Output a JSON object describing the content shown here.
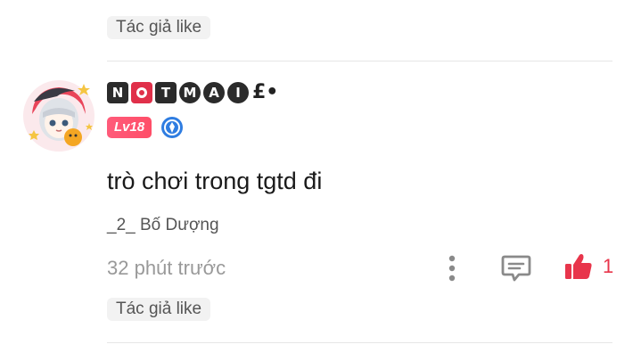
{
  "top_comment": {
    "author_like_label": "Tác giả like"
  },
  "comment": {
    "username_chars": [
      "N",
      "O",
      "T",
      "M",
      "A",
      "I"
    ],
    "username_tail": "£•",
    "level_badge": "Lv18",
    "text": "trò chơi trong tgtd đi",
    "signature": "_2_ Bố Dượng",
    "timestamp": "32 phút trước",
    "like_count": "1",
    "author_like_label": "Tác giả like"
  },
  "colors": {
    "accent": "#e8354b",
    "level_badge": "#ff5b7a",
    "medal": "#2f7de1"
  },
  "icons": [
    "more-vertical-icon",
    "comment-reply-icon",
    "thumbs-up-icon",
    "medal-icon"
  ]
}
